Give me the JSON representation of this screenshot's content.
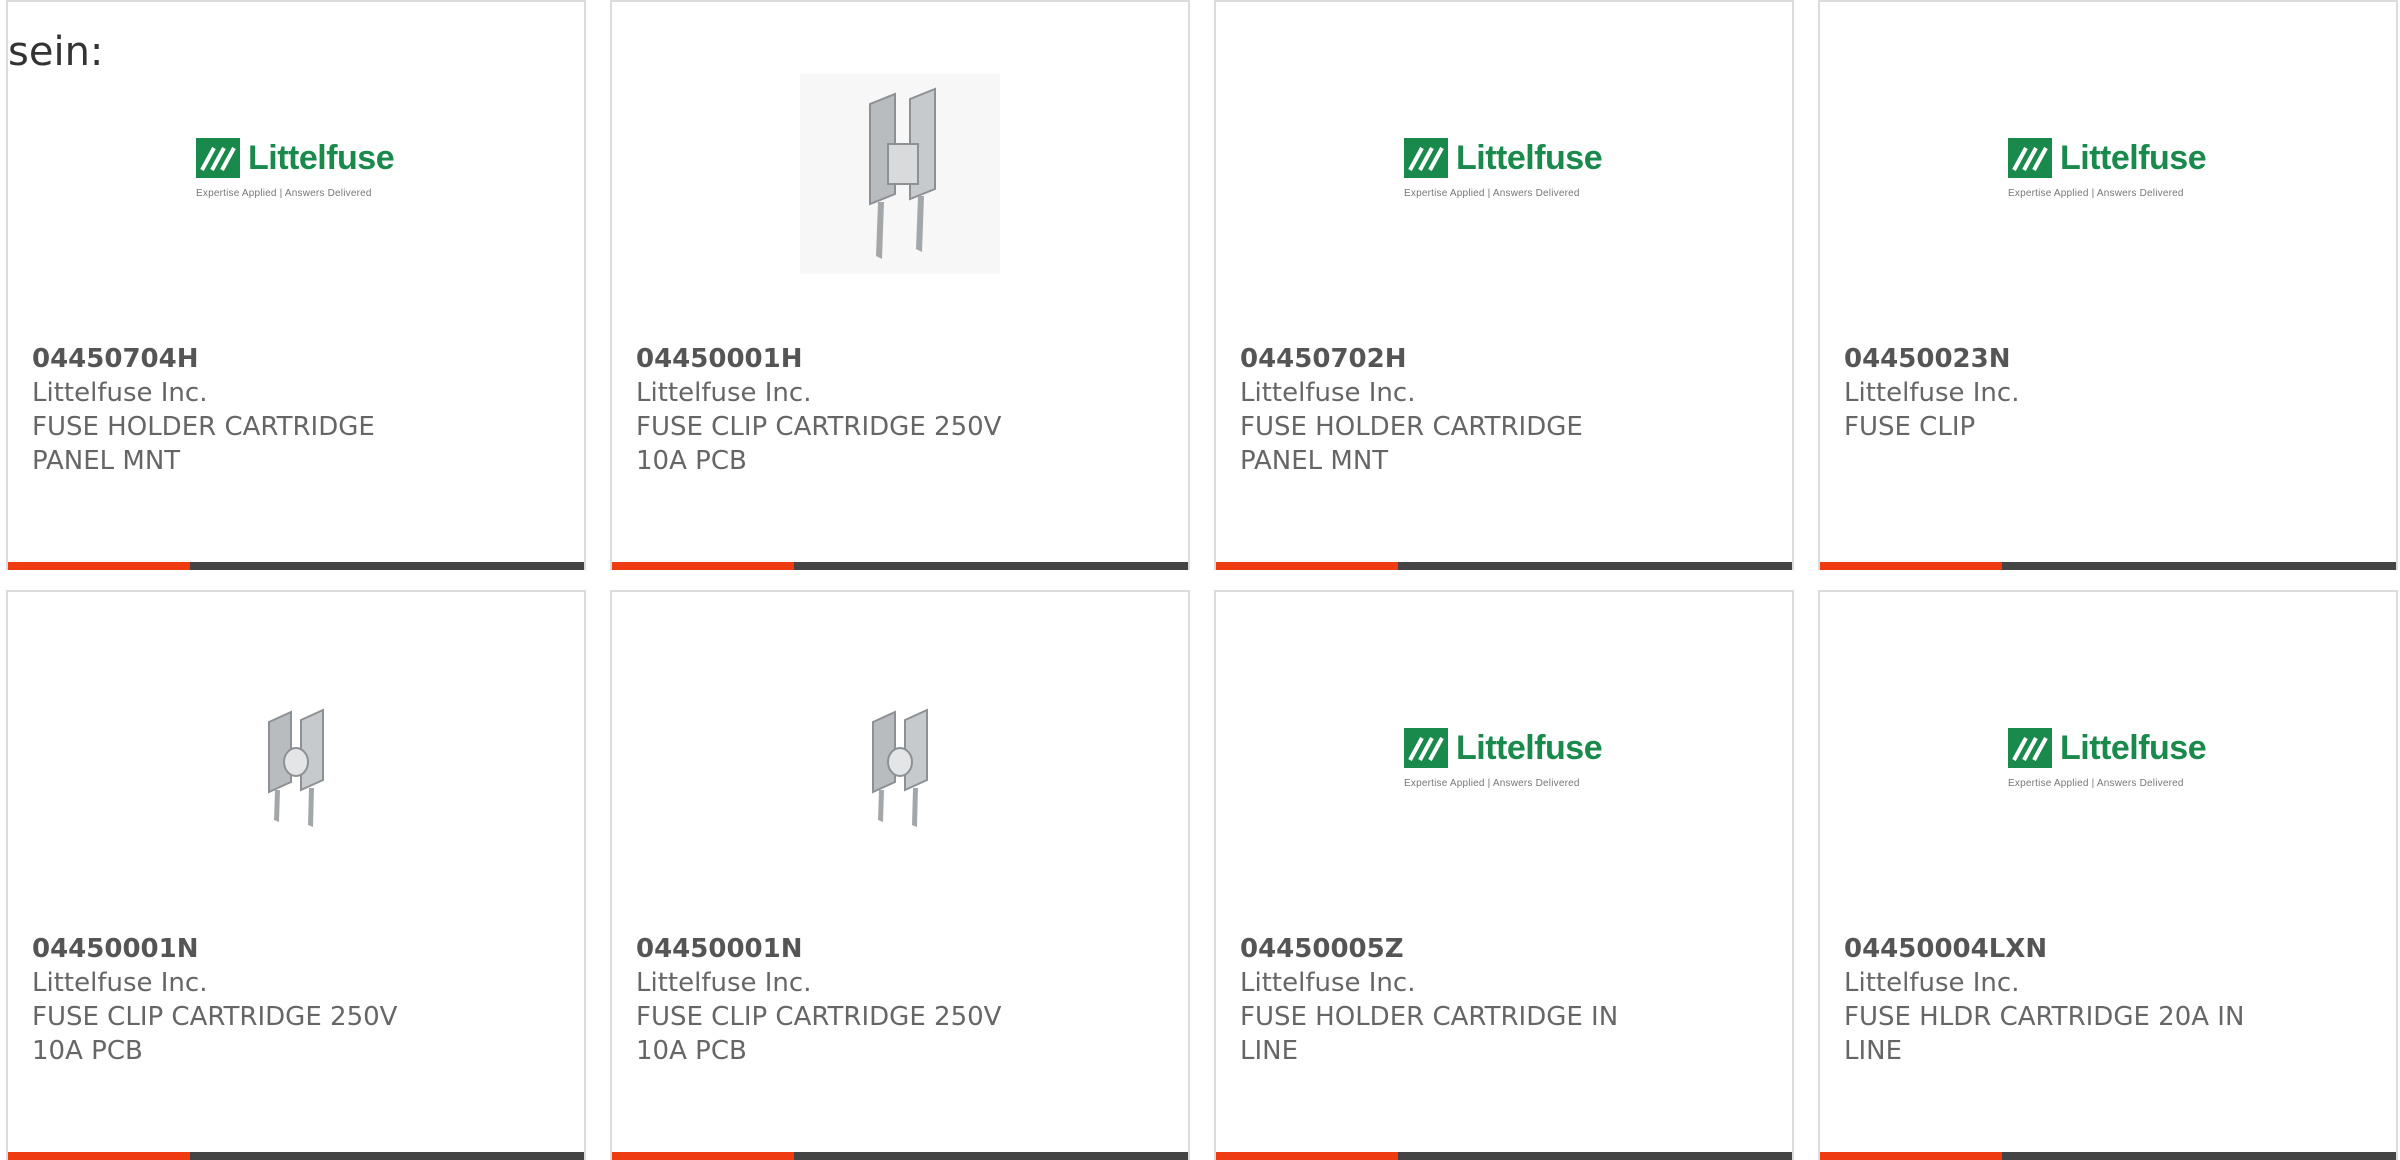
{
  "intro_text": "sein:",
  "colors": {
    "accent": "#ee3b12",
    "bar": "#444444",
    "logo_green": "#1a8a4c",
    "border": "#dcdcdc"
  },
  "logo": {
    "brand": "Littelfuse",
    "tagline": "Expertise Applied | Answers Delivered"
  },
  "products": [
    {
      "part": "04450704H",
      "manufacturer": "Littelfuse Inc.",
      "description": "FUSE HOLDER CARTRIDGE PANEL MNT",
      "image": "littelfuse-logo"
    },
    {
      "part": "04450001H",
      "manufacturer": "Littelfuse Inc.",
      "description": "FUSE CLIP CARTRIDGE 250V 10A PCB",
      "image": "fuse-clip-photo"
    },
    {
      "part": "04450702H",
      "manufacturer": "Littelfuse Inc.",
      "description": "FUSE HOLDER CARTRIDGE PANEL MNT",
      "image": "littelfuse-logo"
    },
    {
      "part": "04450023N",
      "manufacturer": "Littelfuse Inc.",
      "description": "FUSE CLIP",
      "image": "littelfuse-logo"
    },
    {
      "part": "04450001N",
      "manufacturer": "Littelfuse Inc.",
      "description": "FUSE CLIP CARTRIDGE 250V 10A PCB",
      "image": "fuse-clip-small-photo"
    },
    {
      "part": "04450001N",
      "manufacturer": "Littelfuse Inc.",
      "description": "FUSE CLIP CARTRIDGE 250V 10A PCB",
      "image": "fuse-clip-small-photo"
    },
    {
      "part": "04450005Z",
      "manufacturer": "Littelfuse Inc.",
      "description": "FUSE HOLDER CARTRIDGE IN LINE",
      "image": "littelfuse-logo"
    },
    {
      "part": "04450004LXN",
      "manufacturer": "Littelfuse Inc.",
      "description": "FUSE HLDR CARTRIDGE 20A IN LINE",
      "image": "littelfuse-logo"
    }
  ]
}
